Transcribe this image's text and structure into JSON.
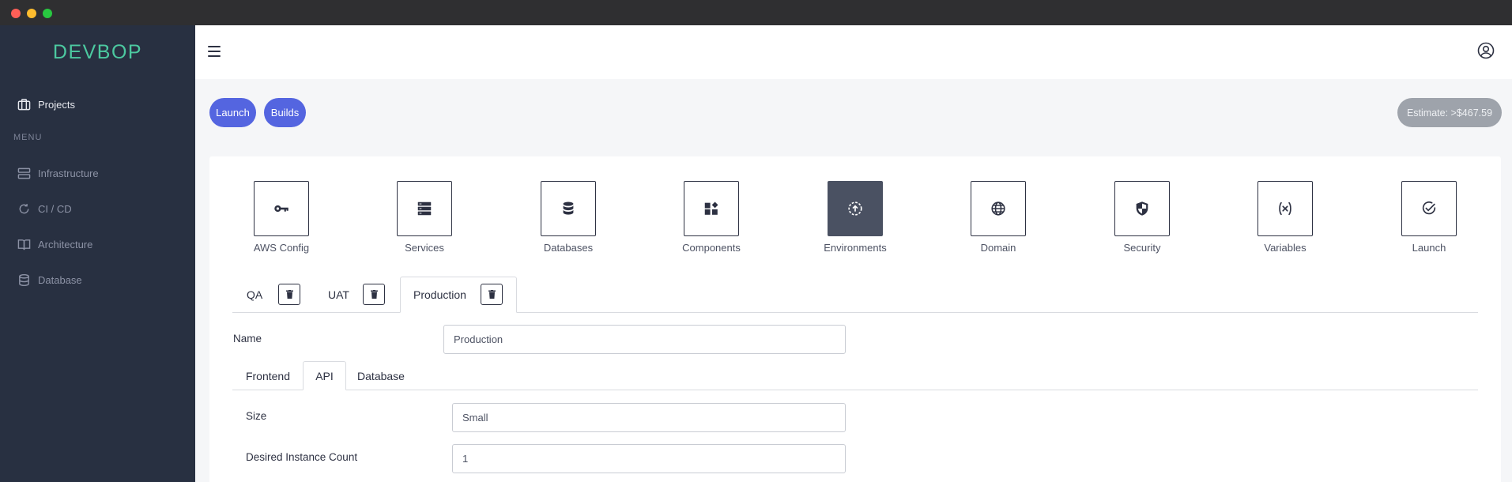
{
  "window": {
    "controls": [
      "close",
      "minimize",
      "zoom"
    ]
  },
  "brand": "DEVBOP",
  "sidebar": {
    "projects_label": "Projects",
    "menu_label": "MENU",
    "items": [
      {
        "label": "Infrastructure",
        "icon": "server-icon"
      },
      {
        "label": "CI / CD",
        "icon": "refresh-icon"
      },
      {
        "label": "Architecture",
        "icon": "book-icon"
      },
      {
        "label": "Database",
        "icon": "database-icon"
      }
    ]
  },
  "toolbar": {
    "launch_label": "Launch",
    "builds_label": "Builds",
    "estimate_label": "Estimate: >$467.59"
  },
  "steps": [
    {
      "label": "AWS Config",
      "icon": "key-icon"
    },
    {
      "label": "Services",
      "icon": "server-stack-icon"
    },
    {
      "label": "Databases",
      "icon": "database-icon"
    },
    {
      "label": "Components",
      "icon": "widgets-icon"
    },
    {
      "label": "Environments",
      "icon": "upload-circle-icon",
      "active": true
    },
    {
      "label": "Domain",
      "icon": "globe-icon"
    },
    {
      "label": "Security",
      "icon": "shield-icon"
    },
    {
      "label": "Variables",
      "icon": "variable-icon"
    },
    {
      "label": "Launch",
      "icon": "check-circle-icon"
    }
  ],
  "environment_tabs": [
    {
      "label": "QA"
    },
    {
      "label": "UAT"
    },
    {
      "label": "Production",
      "active": true
    }
  ],
  "form": {
    "name_label": "Name",
    "name_value": "Production",
    "sub_tabs": [
      {
        "label": "Frontend"
      },
      {
        "label": "API",
        "active": true
      },
      {
        "label": "Database"
      }
    ],
    "size_label": "Size",
    "size_value": "Small",
    "instance_count_label": "Desired Instance Count",
    "instance_count_value": "1"
  },
  "colors": {
    "sidebar_bg": "#283041",
    "brand": "#4cc9a0",
    "primary_button": "#5465e0",
    "estimate_bg": "#9ea3ab",
    "active_step": "#4a5162"
  }
}
